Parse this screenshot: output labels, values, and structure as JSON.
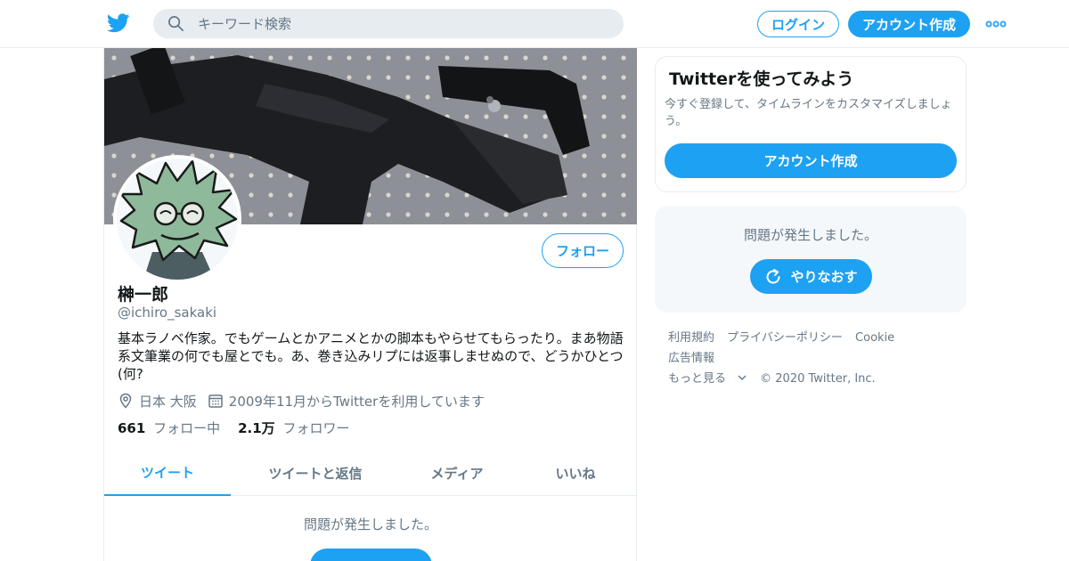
{
  "header": {
    "logo_icon": "twitter-bird-icon",
    "search_placeholder": "キーワード検索",
    "login_label": "ログイン",
    "signup_label": "アカウント作成",
    "more_icon": "more-dots-icon"
  },
  "profile": {
    "display_name": "榊一郎",
    "handle": "@ichiro_sakaki",
    "bio": "基本ラノベ作家。でもゲームとかアニメとかの脚本もやらせてもらったり。まあ物語系文筆業の何でも屋とでも。あ、巻き込みリプには返事しませぬので、どうかひとつ(何?",
    "location": "日本 大阪",
    "joined": "2009年11月からTwitterを利用しています",
    "follow_label": "フォロー",
    "following_count": "661",
    "following_label": "フォロー中",
    "followers_count": "2.1万",
    "followers_label": "フォロワー"
  },
  "tabs": [
    {
      "label": "ツイート",
      "active": true
    },
    {
      "label": "ツイートと返信",
      "active": false
    },
    {
      "label": "メディア",
      "active": false
    },
    {
      "label": "いいね",
      "active": false
    }
  ],
  "timeline": {
    "error_text": "問題が発生しました。"
  },
  "sidebar": {
    "signup_card": {
      "title": "Twitterを使ってみよう",
      "text": "今すぐ登録して、タイムラインをカスタマイズしましょう。",
      "button_label": "アカウント作成"
    },
    "error_card": {
      "text": "問題が発生しました。",
      "retry_label": "やりなおす"
    },
    "footer_links": [
      "利用規約",
      "プライバシーポリシー",
      "Cookie",
      "広告情報",
      "もっと見る"
    ],
    "copyright": "© 2020 Twitter, Inc."
  },
  "colors": {
    "accent": "#1da1f2",
    "muted_text": "#657786",
    "border": "#e6ecf0"
  }
}
